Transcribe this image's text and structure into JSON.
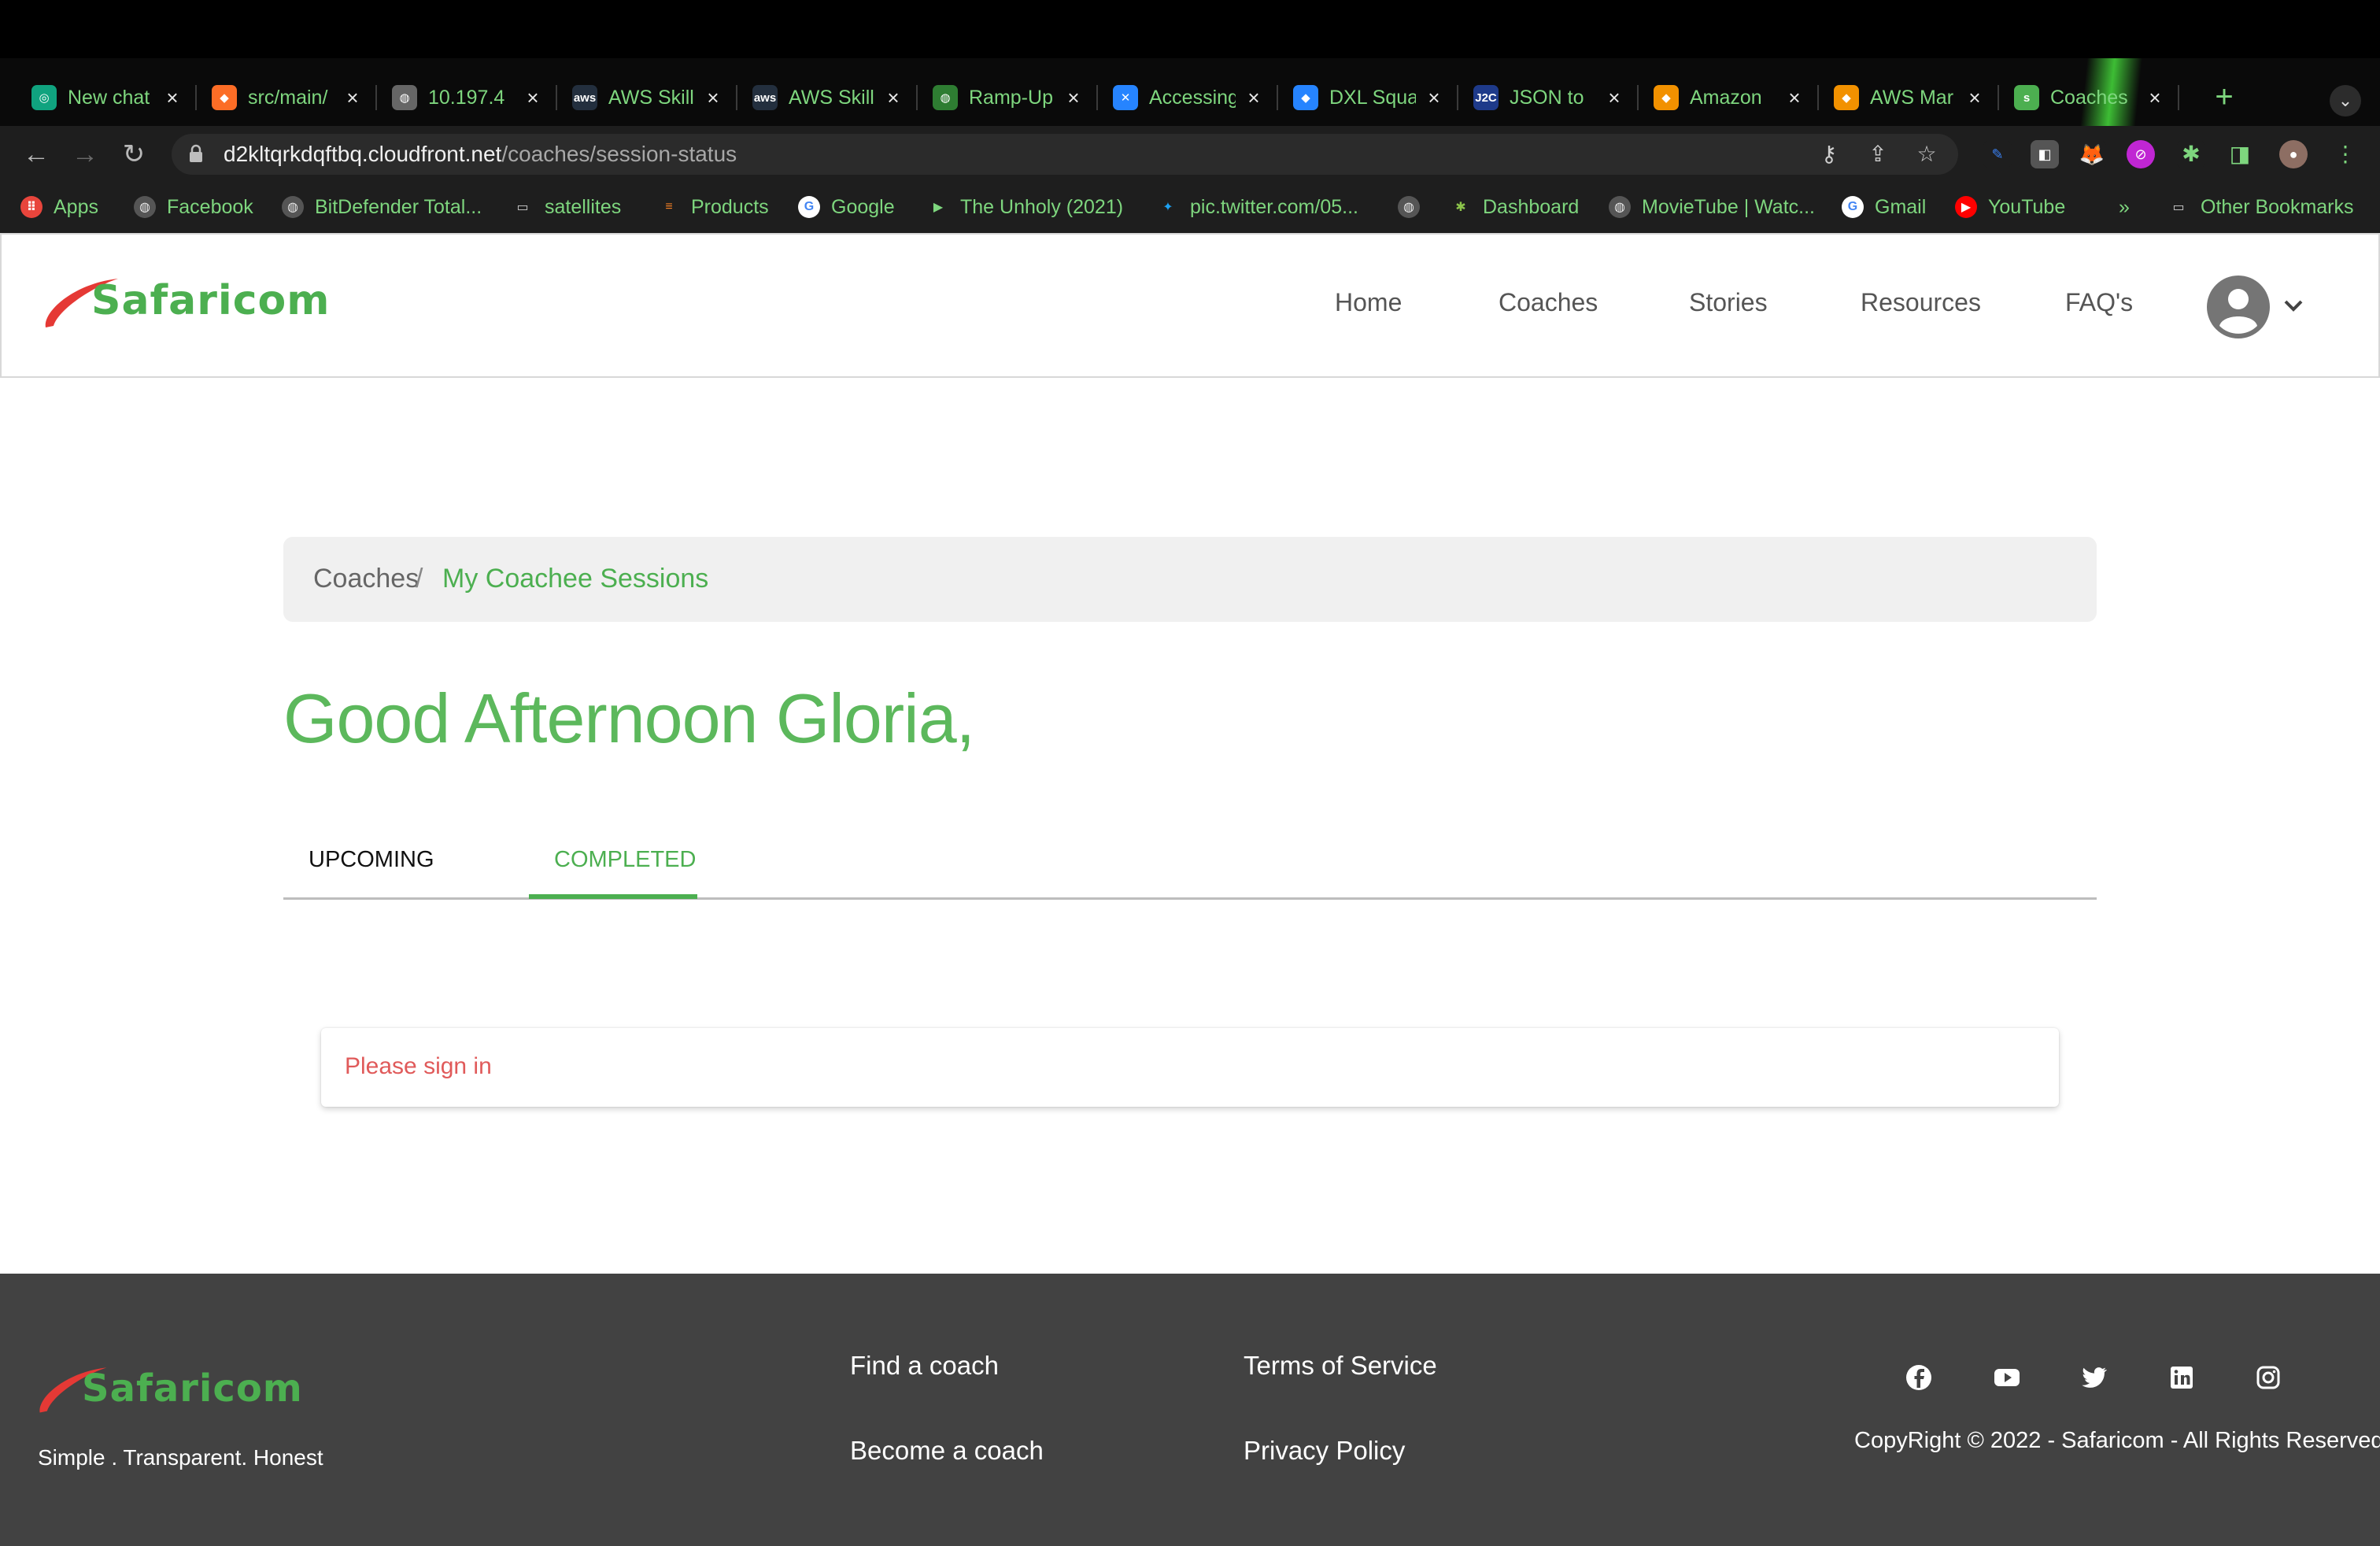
{
  "browser": {
    "tabs": [
      {
        "label": "New chat",
        "icon": "openai-icon",
        "color": "#10a37f",
        "glyph": "◎"
      },
      {
        "label": "src/main/",
        "icon": "gitlab-icon",
        "color": "#fc6d26",
        "glyph": "◆"
      },
      {
        "label": "10.197.4",
        "icon": "globe-icon",
        "color": "#666666",
        "glyph": "◍"
      },
      {
        "label": "AWS Skill",
        "icon": "aws-icon",
        "color": "#232f3e",
        "glyph": "aws"
      },
      {
        "label": "AWS Skill",
        "icon": "aws-icon",
        "color": "#232f3e",
        "glyph": "aws"
      },
      {
        "label": "Ramp-Up",
        "icon": "globe-icon",
        "color": "#2e7d32",
        "glyph": "◍"
      },
      {
        "label": "Accessing",
        "icon": "confluence-icon",
        "color": "#2684ff",
        "glyph": "✕"
      },
      {
        "label": "DXL Squad",
        "icon": "jira-icon",
        "color": "#2684ff",
        "glyph": "◆"
      },
      {
        "label": "JSON to",
        "icon": "json-icon",
        "color": "#1e3a8a",
        "glyph": "J2C"
      },
      {
        "label": "Amazon",
        "icon": "aws-box-icon",
        "color": "#f29100",
        "glyph": "◆"
      },
      {
        "label": "AWS Mar",
        "icon": "aws-box-icon",
        "color": "#f29100",
        "glyph": "◆"
      },
      {
        "label": "Coaches",
        "icon": "safaricom-favicon-icon",
        "color": "#4caf50",
        "glyph": "s"
      }
    ],
    "url_host": "d2kltqrkdqftbq.cloudfront.net",
    "url_path": "/coaches/session-status",
    "bookmarks": [
      {
        "label": "Apps",
        "icon": "apps-grid-icon"
      },
      {
        "label": "Facebook",
        "icon": "globe-icon"
      },
      {
        "label": "BitDefender Total...",
        "icon": "globe-icon"
      },
      {
        "label": "satellites",
        "icon": "folder-icon"
      },
      {
        "label": "Products",
        "icon": "stackoverflow-icon"
      },
      {
        "label": "Google",
        "icon": "google-icon"
      },
      {
        "label": "The Unholy (2021)",
        "icon": "play-icon"
      },
      {
        "label": "pic.twitter.com/05...",
        "icon": "twitter-icon"
      },
      {
        "label": "",
        "icon": "globe-icon"
      },
      {
        "label": "Dashboard",
        "icon": "palm-icon"
      },
      {
        "label": "MovieTube | Watc...",
        "icon": "globe-icon"
      },
      {
        "label": "Gmail",
        "icon": "google-icon"
      },
      {
        "label": "YouTube",
        "icon": "youtube-icon"
      },
      {
        "label": "»",
        "icon": ""
      },
      {
        "label": "Other Bookmarks",
        "icon": "folder-icon"
      }
    ]
  },
  "site": {
    "brand": "Safaricom",
    "nav": [
      "Home",
      "Coaches",
      "Stories",
      "Resources",
      "FAQ's"
    ]
  },
  "breadcrumb": {
    "parent": "Coaches",
    "separator": "/",
    "current": "My Coachee Sessions"
  },
  "greeting": "Good Afternoon Gloria,",
  "session_tabs": {
    "upcoming": "UPCOMING",
    "completed": "COMPLETED",
    "active": "completed"
  },
  "alert": "Please sign in",
  "footer": {
    "brand": "Safaricom",
    "tagline": "Simple . Transparent. Honest",
    "links": {
      "find_coach": "Find a coach",
      "become_coach": "Become a coach",
      "terms": "Terms of Service",
      "privacy": "Privacy Policy"
    },
    "social": [
      "facebook-icon",
      "youtube-icon",
      "twitter-icon",
      "linkedin-icon",
      "instagram-icon"
    ],
    "copyright": "CopyRight © 2022 - Safaricom - All Rights Reserved"
  },
  "colors": {
    "brand_green": "#4caf50",
    "brand_red": "#e53935",
    "alert_red": "#e05a5a",
    "footer_bg": "#424242"
  }
}
